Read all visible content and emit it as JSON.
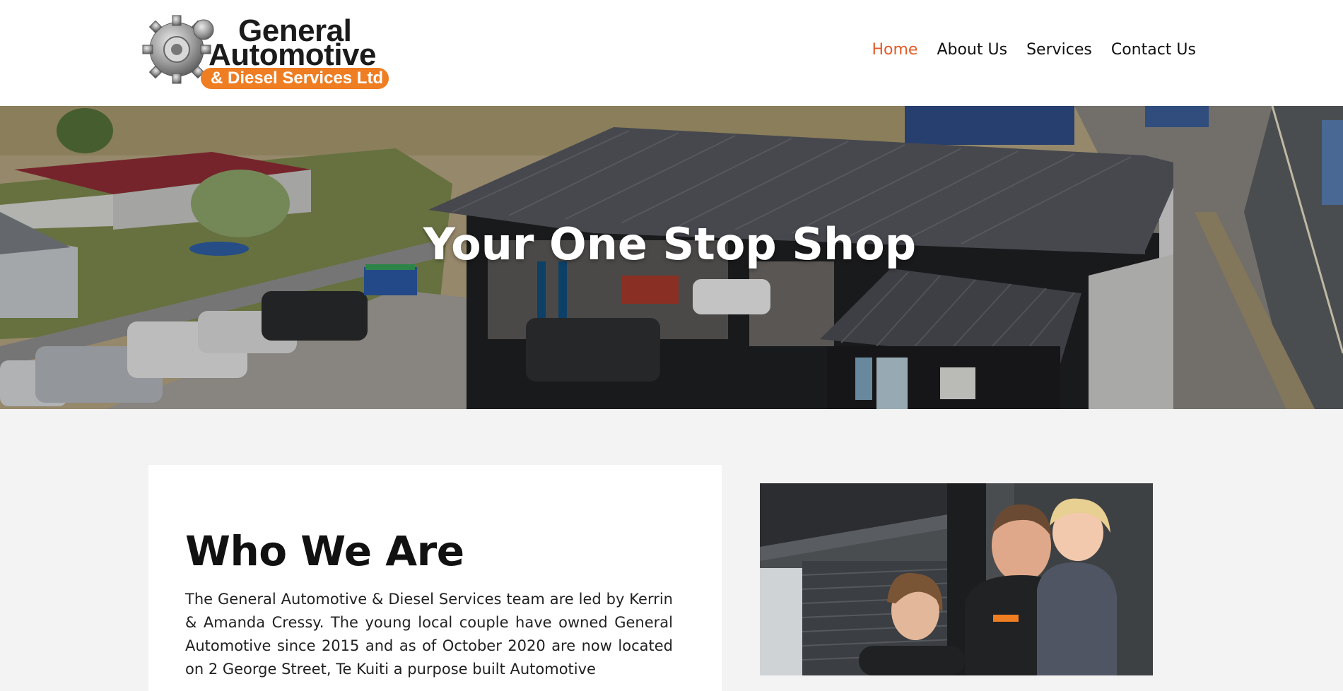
{
  "logo": {
    "line1": "General",
    "line2": "Automotive",
    "line3": "& Diesel Services Ltd",
    "icon": "gear-logo-icon",
    "accent_color": "#ef7d22"
  },
  "nav": {
    "items": [
      {
        "label": "Home",
        "active": true
      },
      {
        "label": "About Us",
        "active": false
      },
      {
        "label": "Services",
        "active": false
      },
      {
        "label": "Contact Us",
        "active": false
      }
    ],
    "active_color": "#e35a26"
  },
  "hero": {
    "title": "Your One Stop Shop"
  },
  "who_we_are": {
    "heading": "Who We Are",
    "body": "The General Automotive & Diesel Services team are led by Kerrin & Amanda Cressy. The young local couple have owned General Automotive since 2015 and as of October 2020 are now located on 2 George Street, Te Kuiti a purpose built Automotive"
  }
}
